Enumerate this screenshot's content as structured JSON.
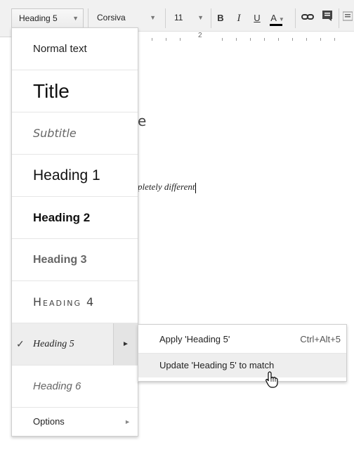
{
  "toolbar": {
    "style_value": "Heading 5",
    "font_value": "Corsiva",
    "size_value": "11",
    "bold_label": "B",
    "italic_label": "I",
    "underline_label": "U",
    "textcolor_label": "A"
  },
  "ruler": {
    "mark": "2"
  },
  "document": {
    "fragment_1": "e",
    "fragment_2": "pletely different"
  },
  "style_menu": {
    "items": [
      {
        "label": "Normal text"
      },
      {
        "label": "Title"
      },
      {
        "label": "Subtitle"
      },
      {
        "label": "Heading 1"
      },
      {
        "label": "Heading 2"
      },
      {
        "label": "Heading 3"
      },
      {
        "label": "Heading 4"
      },
      {
        "label": "Heading 5",
        "selected": true
      },
      {
        "label": "Heading 6"
      }
    ],
    "check_glyph": "✓",
    "submenu_arrow": "►",
    "options_label": "Options",
    "options_arrow": "►"
  },
  "submenu": {
    "apply_label": "Apply 'Heading 5'",
    "apply_shortcut": "Ctrl+Alt+5",
    "update_label": "Update 'Heading 5' to match"
  },
  "colors": {
    "toolbar_bg": "#f1f1f1",
    "selected_bg": "#eeeeee",
    "text_color_underline": "#000000"
  }
}
